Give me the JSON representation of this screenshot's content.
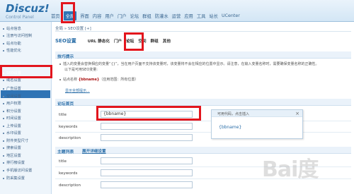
{
  "app": {
    "logo_title": "Discuz!",
    "logo_sub": "Control Panel"
  },
  "topnav": [
    "首页",
    "全局",
    "界面",
    "内容",
    "用户",
    "门户",
    "论坛",
    "群组",
    "防灌水",
    "运营",
    "应用",
    "工具",
    "站长",
    "UCenter"
  ],
  "sidebar": [
    "站点信息",
    "注册与访问控制",
    "站点功能",
    "性能优化",
    "SEO设置",
    "域名设置",
    "广告设置",
    "空间设置",
    "用户权限",
    "积分设置",
    "时间设置",
    "上传设置",
    "水印设置",
    "附件类型尺寸",
    "搜索设置",
    "地区设置",
    "排行榜设置",
    "手机版访问设置",
    "防采集设置"
  ],
  "breadcrumb": "全局 » SEO设置  [+]",
  "subnav": {
    "title": "SEO设置",
    "tabs": [
      "URL 静态化",
      "门户",
      "论坛",
      "空间",
      "群组",
      "其他"
    ],
    "active": "论坛"
  },
  "tips": {
    "header": "技巧提示",
    "line1": "插入的变量会替换相应的变量“{}”，当在用户页面不支持该变量时，该变量将不会在相应的位置中显示。请注意，在输入变量名称时，需要确保变量名称的正确性。",
    "line2": "以下是可用SEO变量:",
    "line3a": "站点名称",
    "line3b": "{bbname}",
    "line3c": "（应用范围：所有位置）",
    "link": "显示全部提示..."
  },
  "forum_index": {
    "header": "论坛首页",
    "fields": [
      {
        "label": "title",
        "value": "{bbname}"
      },
      {
        "label": "keywords",
        "value": ""
      },
      {
        "label": "description",
        "value": ""
      }
    ]
  },
  "popup": {
    "header": "可用代码，点击插入",
    "close": "×",
    "item": "{bbname}"
  },
  "theme_list": {
    "header": "主题列表",
    "link": "展开详细设置",
    "fields": [
      {
        "label": "title",
        "value": ""
      },
      {
        "label": "keywords",
        "value": ""
      },
      {
        "label": "description",
        "value": ""
      }
    ]
  },
  "watermark": "Bai度"
}
